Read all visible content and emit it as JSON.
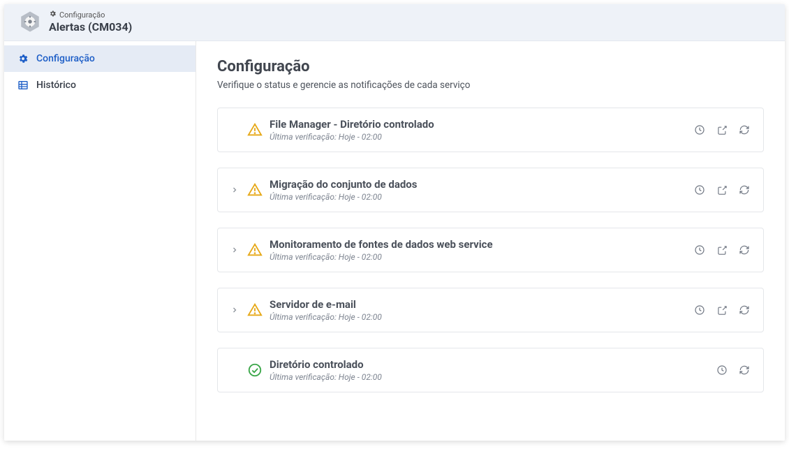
{
  "header": {
    "breadcrumb_label": "Configuração",
    "title": "Alertas (CM034)"
  },
  "sidebar": {
    "items": [
      {
        "label": "Configuração",
        "active": true,
        "icon": "gear"
      },
      {
        "label": "Histórico",
        "active": false,
        "icon": "table"
      }
    ]
  },
  "main": {
    "title": "Configuração",
    "subtitle": "Verifique o status e gerencie as notificações de cada serviço",
    "last_check_prefix": "Última verificação: ",
    "services": [
      {
        "title": "File Manager - Diretório controlado",
        "last_check": "Hoje - 02:00",
        "status": "warning",
        "expandable": false,
        "has_external": true
      },
      {
        "title": "Migração do conjunto de dados",
        "last_check": "Hoje - 02:00",
        "status": "warning",
        "expandable": true,
        "has_external": true
      },
      {
        "title": "Monitoramento de fontes de dados web service",
        "last_check": "Hoje - 02:00",
        "status": "warning",
        "expandable": true,
        "has_external": true
      },
      {
        "title": "Servidor de e-mail",
        "last_check": "Hoje - 02:00",
        "status": "warning",
        "expandable": true,
        "has_external": true
      },
      {
        "title": "Diretório controlado",
        "last_check": "Hoje - 02:00",
        "status": "ok",
        "expandable": false,
        "has_external": false
      }
    ]
  }
}
